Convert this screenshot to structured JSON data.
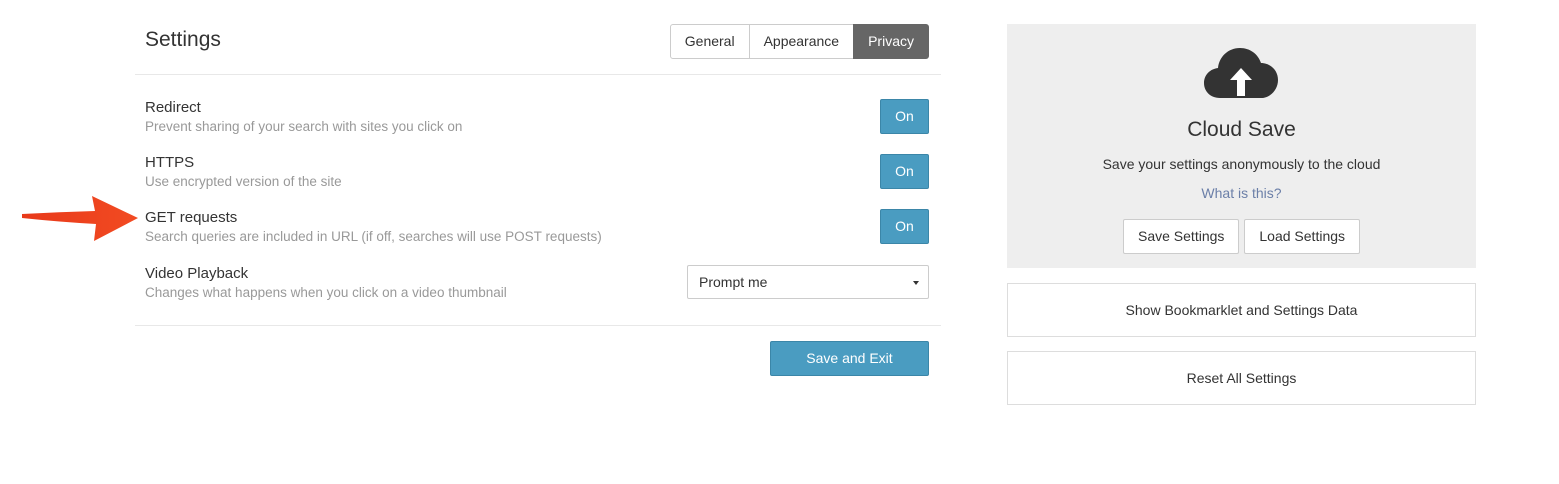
{
  "settings": {
    "title": "Settings",
    "tabs": [
      {
        "label": "General"
      },
      {
        "label": "Appearance"
      },
      {
        "label": "Privacy"
      }
    ],
    "active_tab": "Privacy",
    "rows": [
      {
        "name": "Redirect",
        "description": "Prevent sharing of your search with sites you click on",
        "value": "On"
      },
      {
        "name": "HTTPS",
        "description": "Use encrypted version of the site",
        "value": "On"
      },
      {
        "name": "GET requests",
        "description": "Search queries are included in URL (if off, searches will use POST requests)",
        "value": "On"
      },
      {
        "name": "Video Playback",
        "description": "Changes what happens when you click on a video thumbnail",
        "value": "Prompt me"
      }
    ],
    "save_exit_label": "Save and Exit"
  },
  "cloud": {
    "icon": "cloud-upload-icon",
    "title": "Cloud Save",
    "description": "Save your settings anonymously to the cloud",
    "link": "What is this?",
    "save_label": "Save Settings",
    "load_label": "Load Settings"
  },
  "actions": {
    "bookmarklet_label": "Show Bookmarklet and Settings Data",
    "reset_label": "Reset All Settings"
  },
  "annotation": {
    "arrow_color": "#f0421c",
    "arrow_icon": "red-arrow-icon"
  },
  "colors": {
    "accent": "#4a9cc1",
    "active_tab": "#666666",
    "panel_bg": "#eeeeee"
  }
}
